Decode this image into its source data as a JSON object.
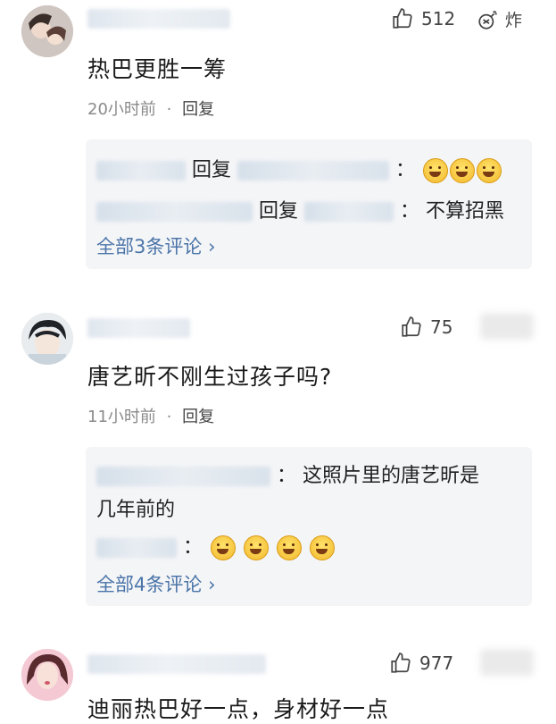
{
  "comments": [
    {
      "likes": "512",
      "bomb_label": "炸",
      "text": "热巴更胜一筹",
      "time": "20小时前",
      "dot": "·",
      "reply_label": "回复",
      "replies": [
        {
          "segments": [
            "回复",
            "："
          ]
        },
        {
          "segments": [
            "回复",
            "：",
            "不算招黑"
          ]
        }
      ],
      "see_all": "全部3条评论"
    },
    {
      "likes": "75",
      "text": "唐艺昕不刚生过孩子吗?",
      "time": "11小时前",
      "dot": "·",
      "reply_label": "回复",
      "replies": [
        {
          "segments": [
            "：",
            "这照片里的唐艺昕是"
          ],
          "continued": "几年前的"
        },
        {
          "segments": [
            "："
          ]
        }
      ],
      "see_all": "全部4条评论"
    },
    {
      "likes": "977",
      "text": "迪丽热巴好一点，身材好一点"
    }
  ],
  "chevron": "›",
  "colors": {
    "link": "#4a74a8",
    "meta": "#8a8a8a",
    "reply_bg": "#f4f5f7"
  }
}
